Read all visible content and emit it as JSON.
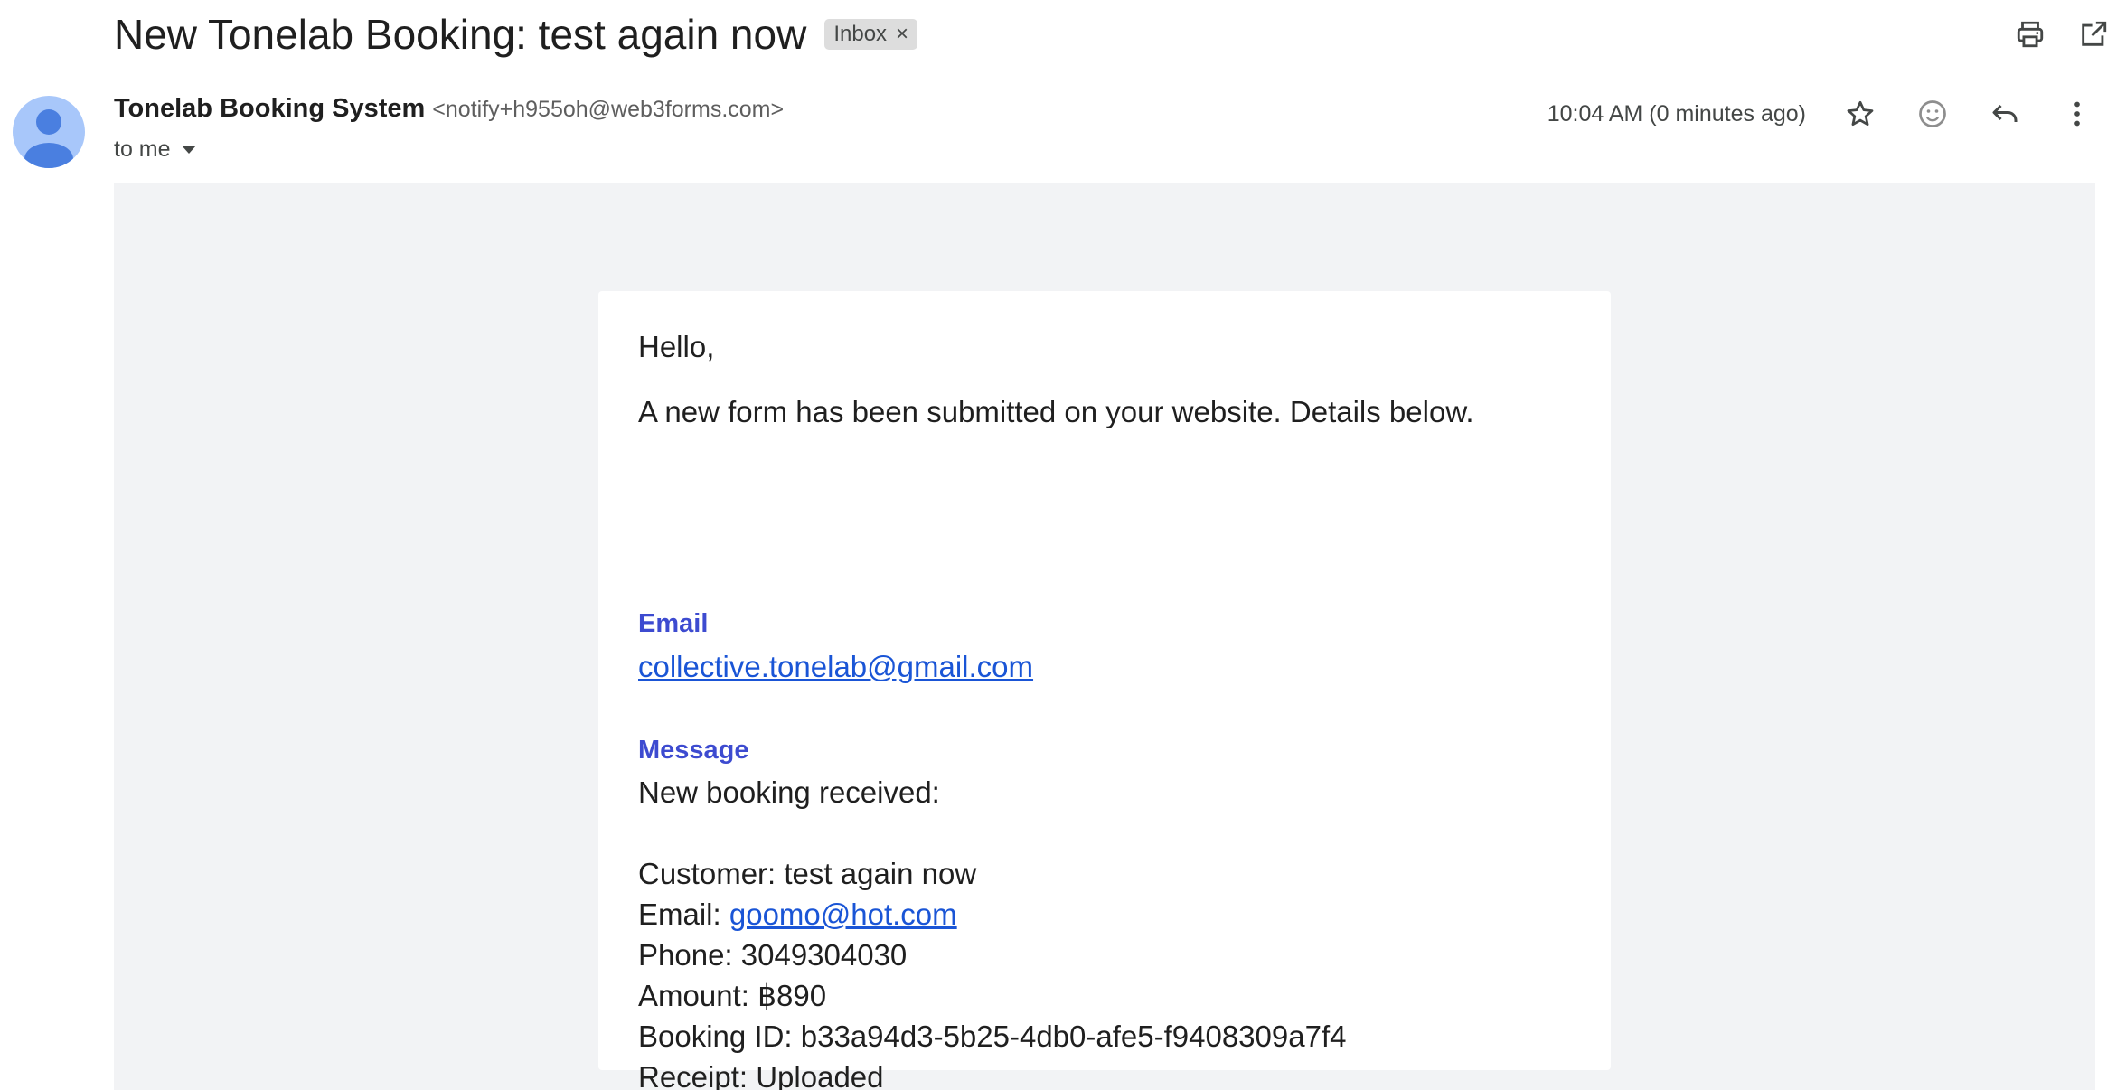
{
  "header": {
    "subject": "New Tonelab Booking: test again now",
    "label": "Inbox",
    "label_remove": "×"
  },
  "sender": {
    "name": "Tonelab Booking System",
    "email": "<notify+h955oh@web3forms.com>",
    "recipient": "to me",
    "timestamp": "10:04 AM (0 minutes ago)"
  },
  "icons": {
    "print": "print-icon",
    "open_new_window": "open-in-new-window-icon",
    "star": "star-icon",
    "emoji": "emoji-reaction-icon",
    "reply": "reply-icon",
    "more": "more-vert-icon",
    "avatar": "avatar-person-icon"
  },
  "colors": {
    "avatar_bg": "#a8c7fa",
    "avatar_fg": "#4a7fe0",
    "field_label": "#3d4bd0",
    "link": "#1a55d6",
    "body_bg": "#f2f3f5"
  },
  "email_body": {
    "greeting": "Hello,",
    "intro": "A new form has been submitted on your website. Details below.",
    "email_label": "Email",
    "email_value": "collective.tonelab@gmail.com",
    "message_label": "Message",
    "message_heading": "New booking received:",
    "customer": "Customer: test again now",
    "email_prefix": "Email: ",
    "email_link": "goomo@hot.com",
    "phone": "Phone: 3049304030",
    "amount": "Amount: ฿890",
    "booking_id": "Booking ID: b33a94d3-5b25-4db0-afe5-f9408309a7f4",
    "receipt": "Receipt: Uploaded"
  }
}
